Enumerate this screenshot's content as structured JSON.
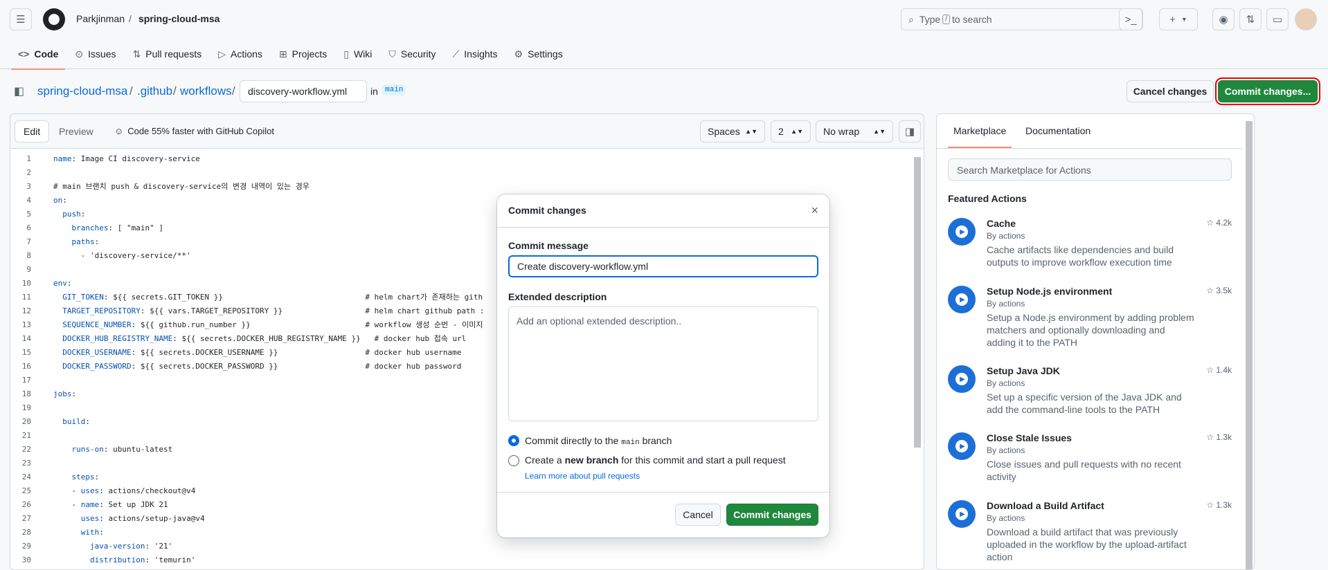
{
  "header": {
    "owner": "Parkjinman",
    "sep": "/",
    "repo": "spring-cloud-msa",
    "search_prefix": "Type",
    "search_key": "/",
    "search_suffix": "to search",
    "plus": "+"
  },
  "tabs": [
    {
      "label": "Code",
      "icon": "code-icon"
    },
    {
      "label": "Issues",
      "icon": "issue-icon"
    },
    {
      "label": "Pull requests",
      "icon": "pull-request-icon"
    },
    {
      "label": "Actions",
      "icon": "play-icon"
    },
    {
      "label": "Projects",
      "icon": "table-icon"
    },
    {
      "label": "Wiki",
      "icon": "book-icon"
    },
    {
      "label": "Security",
      "icon": "shield-icon"
    },
    {
      "label": "Insights",
      "icon": "graph-icon"
    },
    {
      "label": "Settings",
      "icon": "gear-icon"
    }
  ],
  "path": {
    "repo": "spring-cloud-msa",
    "dir1": ".github",
    "dir2": "workflows",
    "sep": "/",
    "filename": "discovery-workflow.yml",
    "in": "in",
    "branch": "main",
    "cancel": "Cancel changes",
    "commit": "Commit changes..."
  },
  "editor": {
    "edit": "Edit",
    "preview": "Preview",
    "copilot": "Code 55% faster with GitHub Copilot",
    "indent_mode": "Spaces",
    "indent_size": "2",
    "wrap": "No wrap",
    "lines": [
      "name: Image CI discovery-service",
      "",
      "# main 브랜치 push & discovery-service의 변경 내역이 있는 경우",
      "on:",
      "  push:",
      "    branches: [ \"main\" ]",
      "    paths:",
      "      - 'discovery-service/**'",
      "",
      "env:",
      "  GIT_TOKEN: ${{ secrets.GIT_TOKEN }}                               # helm chart가 존재하는 gith",
      "  TARGET_REPOSITORY: ${{ vars.TARGET_REPOSITORY }}                  # helm chart github path : ",
      "  SEQUENCE_NUMBER: ${{ github.run_number }}                         # workflow 생성 순번 - 이미지",
      "  DOCKER_HUB_REGISTRY_NAME: ${{ secrets.DOCKER_HUB_REGISTRY_NAME }}   # docker hub 접속 url",
      "  DOCKER_USERNAME: ${{ secrets.DOCKER_USERNAME }}                   # docker hub username",
      "  DOCKER_PASSWORD: ${{ secrets.DOCKER_PASSWORD }}                   # docker hub password",
      "",
      "jobs:",
      "",
      "  build:",
      "",
      "    runs-on: ubuntu-latest",
      "",
      "    steps:",
      "    - uses: actions/checkout@v4",
      "    - name: Set up JDK 21",
      "      uses: actions/setup-java@v4",
      "      with:",
      "        java-version: '21'",
      "        distribution: 'temurin'"
    ]
  },
  "sidepanel": {
    "tab_marketplace": "Marketplace",
    "tab_docs": "Documentation",
    "search_placeholder": "Search Marketplace for Actions",
    "featured": "Featured Actions",
    "actions": [
      {
        "name": "Cache",
        "by": "By actions",
        "stars": "4.2k",
        "desc": "Cache artifacts like dependencies and build outputs to improve workflow execution time"
      },
      {
        "name": "Setup Node.js environment",
        "by": "By actions",
        "stars": "3.5k",
        "desc": "Setup a Node.js environment by adding problem matchers and optionally downloading and adding it to the PATH"
      },
      {
        "name": "Setup Java JDK",
        "by": "By actions",
        "stars": "1.4k",
        "desc": "Set up a specific version of the Java JDK and add the command-line tools to the PATH"
      },
      {
        "name": "Close Stale Issues",
        "by": "By actions",
        "stars": "1.3k",
        "desc": "Close issues and pull requests with no recent activity"
      },
      {
        "name": "Download a Build Artifact",
        "by": "By actions",
        "stars": "1.3k",
        "desc": "Download a build artifact that was previously uploaded in the workflow by the upload-artifact action"
      }
    ]
  },
  "modal": {
    "title": "Commit changes",
    "msg_label": "Commit message",
    "msg_value": "Create discovery-workflow.yml",
    "desc_label": "Extended description",
    "desc_placeholder": "Add an optional extended description..",
    "opt1_a": "Commit directly to the",
    "opt1_branch": "main",
    "opt1_b": "branch",
    "opt2_a": "Create a",
    "opt2_bold": "new branch",
    "opt2_b": "for this commit and start a pull request",
    "opt2_link": "Learn more about pull requests",
    "cancel": "Cancel",
    "commit": "Commit changes"
  },
  "colors": {
    "accent_blue": "#0969da",
    "commit_green": "#1f883d",
    "highlight_red": "#e00000"
  }
}
